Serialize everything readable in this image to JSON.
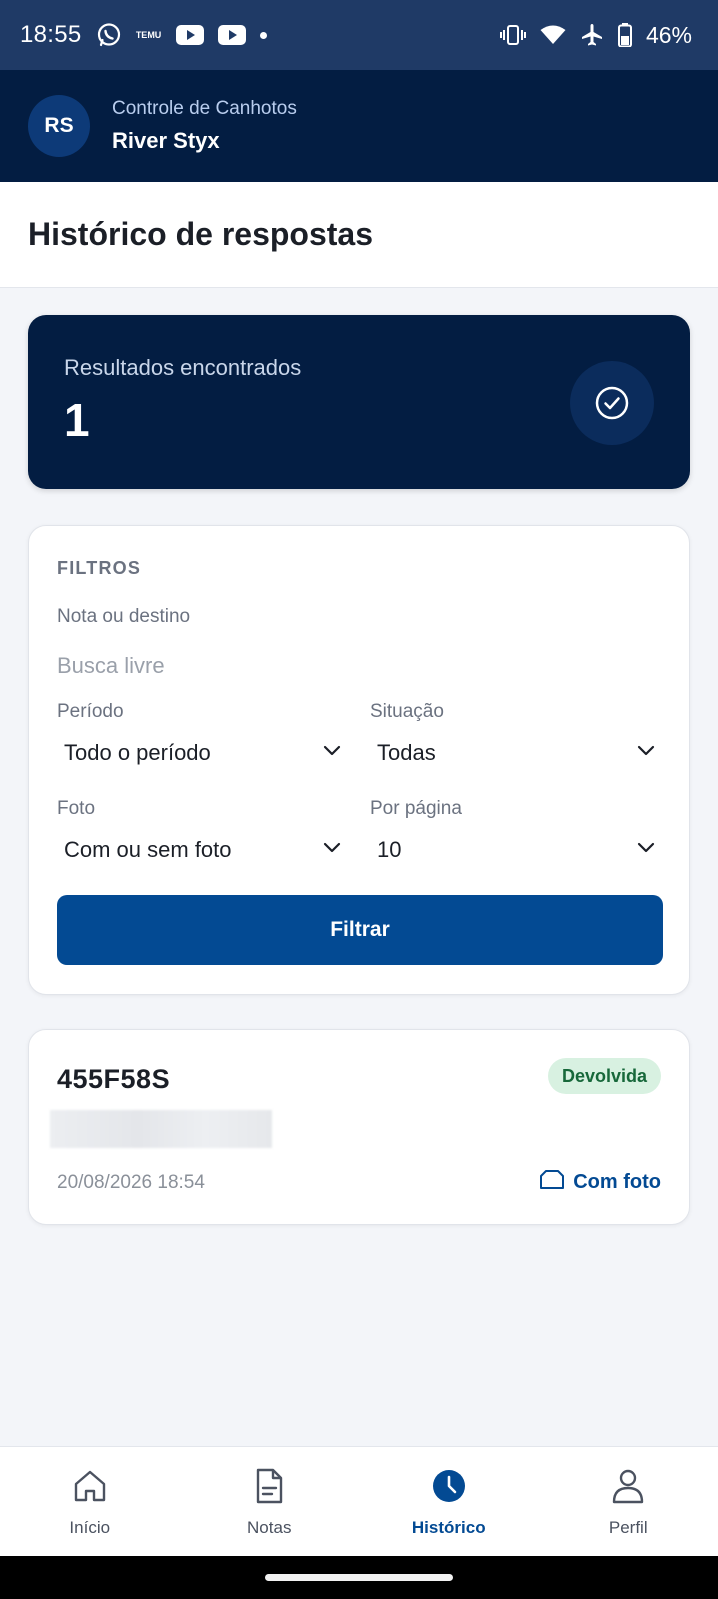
{
  "status_bar": {
    "time": "18:55",
    "app_icons": [
      "whatsapp-icon",
      "temu-icon",
      "youtube-icon",
      "youtube-icon",
      "notification-dot"
    ],
    "temu_text": "TEMU",
    "system_icons": [
      "vibrate-icon",
      "wifi-icon",
      "airplane-icon",
      "battery-icon"
    ],
    "battery_percent": "46%"
  },
  "header": {
    "avatar_initials": "RS",
    "app_subtitle": "Controle de Canhotos",
    "user_name": "River Styx"
  },
  "page": {
    "title": "Histórico de respostas"
  },
  "results": {
    "label": "Resultados encontrados",
    "count": "1",
    "icon": "check-circle-icon"
  },
  "filters": {
    "heading": "FILTROS",
    "search": {
      "label": "Nota ou destino",
      "placeholder": "Busca livre",
      "value": ""
    },
    "period": {
      "label": "Período",
      "value": "Todo o período"
    },
    "situation": {
      "label": "Situação",
      "value": "Todas"
    },
    "photo": {
      "label": "Foto",
      "value": "Com ou sem foto"
    },
    "per_page": {
      "label": "Por página",
      "value": "10"
    },
    "submit_label": "Filtrar"
  },
  "result_items": [
    {
      "code": "455F58S",
      "status": "Devolvida",
      "date": "20/08/2026 18:54",
      "photo_label": "Com foto"
    }
  ],
  "bottom_nav": [
    {
      "label": "Início",
      "icon": "home-icon",
      "active": false
    },
    {
      "label": "Notas",
      "icon": "document-icon",
      "active": false
    },
    {
      "label": "Histórico",
      "icon": "clock-icon",
      "active": true
    },
    {
      "label": "Perfil",
      "icon": "user-icon",
      "active": false
    }
  ],
  "colors": {
    "primary": "#034a93",
    "header_bg": "#031d42",
    "status_bar_bg": "#1f3a66",
    "badge_bg": "#d8f1e1",
    "badge_text": "#17683a"
  }
}
